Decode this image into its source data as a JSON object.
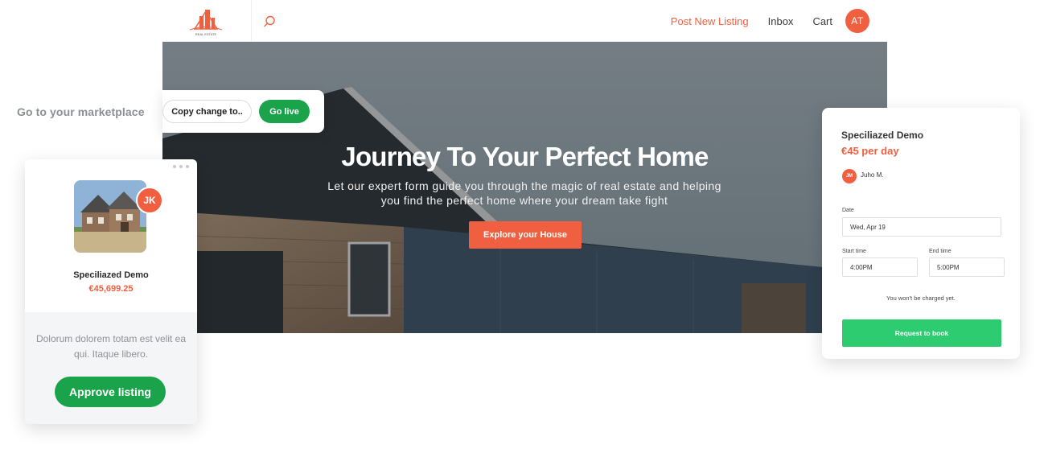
{
  "nav": {
    "logo_text": "REAL ESTATE",
    "search_icon": "search-icon",
    "links": [
      {
        "label": "Post New Listing"
      },
      {
        "label": "Inbox"
      },
      {
        "label": "Cart"
      }
    ],
    "avatar_initials": "AT",
    "accent_color": "#f06040"
  },
  "hero": {
    "title": "Journey To Your Perfect Home",
    "subtitle": "Let our expert form guide you through the magic of real estate and helping you find the perfect home where your dream take fight",
    "cta_label": "Explore your House"
  },
  "marketplace": {
    "label": "Go to your marketplace",
    "copy_label": "Copy change to..",
    "go_live_label": "Go live"
  },
  "listing_card": {
    "avatar_initials": "JK",
    "title": "Speciliazed Demo",
    "price": "€45,699.25",
    "description": "Dolorum dolorem totam est velit ea qui. Itaque libero.",
    "approve_label": "Approve listing"
  },
  "booking": {
    "title": "Speciliazed Demo",
    "price": "€45 per day",
    "host_initials": "JM",
    "host_name": "Juho M.",
    "date_label": "Date",
    "date_value": "Wed, Apr 19",
    "start_label": "Start time",
    "start_value": "4:00PM",
    "end_label": "End time",
    "end_value": "5:00PM",
    "note": "You won't be charged yet.",
    "request_label": "Request to book",
    "button_color": "#2ecc71"
  }
}
